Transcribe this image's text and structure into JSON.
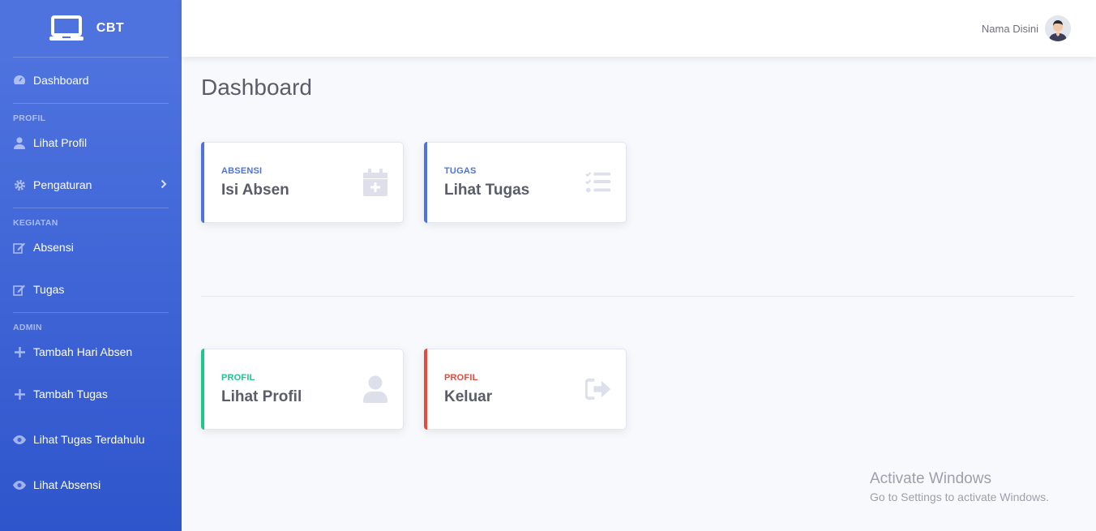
{
  "brand": {
    "name": "CBT"
  },
  "sidebar": {
    "dashboard": "Dashboard",
    "headings": {
      "profil": "PROFIL",
      "kegiatan": "KEGIATAN",
      "admin": "ADMIN"
    },
    "items": {
      "lihat_profil": "Lihat Profil",
      "pengaturan": "Pengaturan",
      "absensi": "Absensi",
      "tugas": "Tugas",
      "tambah_hari_absen": "Tambah Hari Absen",
      "tambah_tugas": "Tambah Tugas",
      "lihat_tugas_terdahulu": "Lihat Tugas Terdahulu",
      "lihat_absensi": "Lihat Absensi"
    }
  },
  "topbar": {
    "user_name": "Nama Disini"
  },
  "page": {
    "title": "Dashboard"
  },
  "cards": [
    {
      "label": "ABSENSI",
      "value": "Isi Absen",
      "color": "#4e73df",
      "icon": "calendar-plus-icon"
    },
    {
      "label": "TUGAS",
      "value": "Lihat Tugas",
      "color": "#4e73df",
      "icon": "tasks-icon"
    },
    {
      "label": "PROFIL",
      "value": "Lihat Profil",
      "color": "#1cc88a",
      "icon": "user-icon"
    },
    {
      "label": "PROFIL",
      "value": "Keluar",
      "color": "#e74a3b",
      "icon": "sign-out-icon"
    }
  ],
  "watermark": {
    "line1": "Activate Windows",
    "line2": "Go to Settings to activate Windows."
  }
}
